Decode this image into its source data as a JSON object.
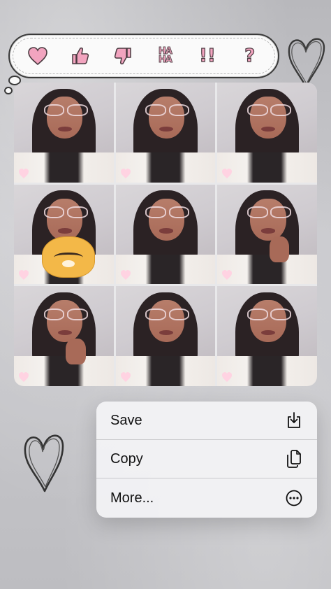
{
  "reactions": [
    {
      "icon": "heart-icon",
      "kind": "heart"
    },
    {
      "icon": "thumbs-up-icon",
      "kind": "thumbs-up"
    },
    {
      "icon": "thumbs-down-icon",
      "kind": "thumbs-down"
    },
    {
      "icon": "haha-icon",
      "kind": "text",
      "line1": "HA",
      "line2": "HA"
    },
    {
      "icon": "double-exclamation-icon",
      "kind": "bang",
      "text": "!!"
    },
    {
      "icon": "question-mark-icon",
      "kind": "bang",
      "text": "?"
    }
  ],
  "reaction_color": "#f2a4bf",
  "photos": [
    {
      "variant": "plain"
    },
    {
      "variant": "plain"
    },
    {
      "variant": "plain"
    },
    {
      "variant": "plush"
    },
    {
      "variant": "plain"
    },
    {
      "variant": "hand"
    },
    {
      "variant": "hand"
    },
    {
      "variant": "plain"
    },
    {
      "variant": "plain"
    }
  ],
  "context_menu": {
    "items": [
      {
        "label": "Save",
        "icon": "save-icon"
      },
      {
        "label": "Copy",
        "icon": "copy-icon"
      },
      {
        "label": "More...",
        "icon": "more-icon"
      }
    ]
  }
}
